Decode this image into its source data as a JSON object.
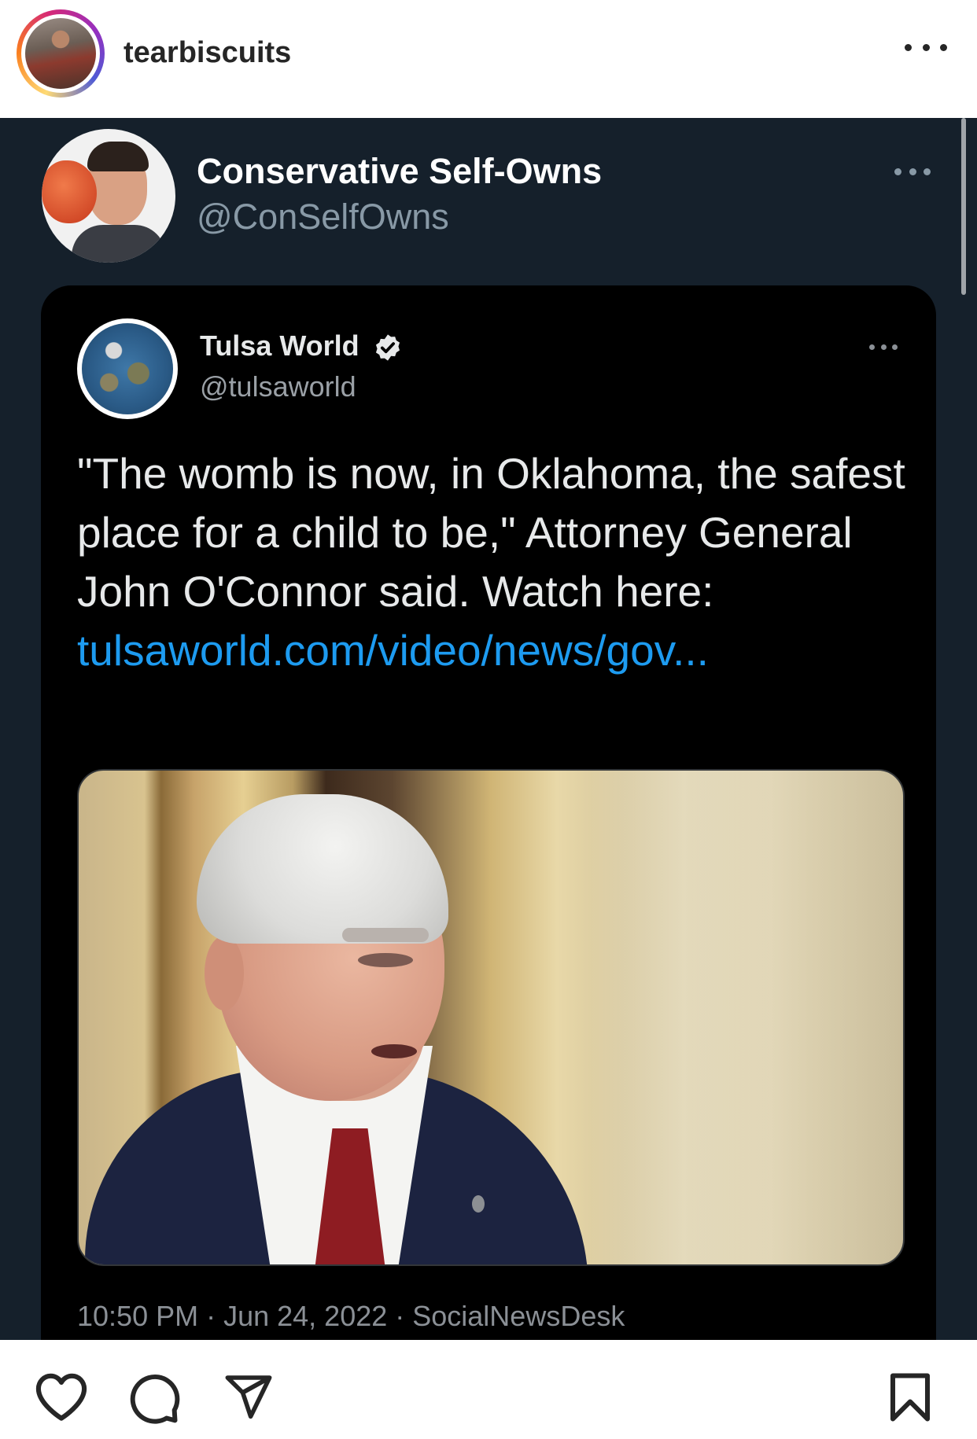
{
  "instagram": {
    "username": "tearbiscuits",
    "more_icon": "more-horizontal-icon"
  },
  "repost": {
    "account_name": "Conservative Self-Owns",
    "account_handle": "@ConSelfOwns",
    "tweet": {
      "author_name": "Tulsa World",
      "author_handle": "@tulsaworld",
      "verified": true,
      "text": "\"The womb is now, in Oklahoma, the safest place for a child to be,\" Attorney General John O'Connor said. Watch here:",
      "link": "tulsaworld.com/video/news/gov...",
      "meta": "10:50 PM · Jun 24, 2022 · SocialNewsDesk"
    }
  },
  "actions": {
    "icons": [
      "heart-icon",
      "comment-icon",
      "share-icon",
      "bookmark-icon"
    ]
  },
  "colors": {
    "tweet_bg": "#15202b",
    "card_bg": "#000000",
    "link": "#1d9bf0",
    "muted": "#8899a6"
  }
}
